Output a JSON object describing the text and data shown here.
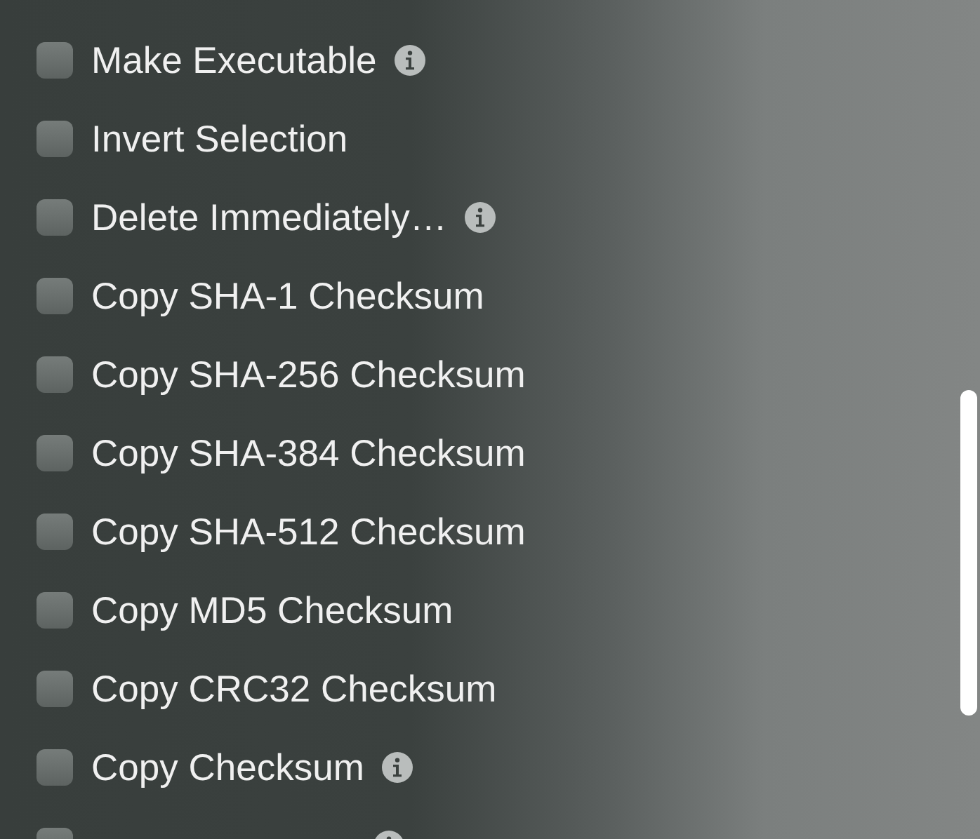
{
  "actions": [
    {
      "label": "Make Executable",
      "checked": false,
      "info": true
    },
    {
      "label": "Invert Selection",
      "checked": false,
      "info": false
    },
    {
      "label": "Delete Immediately…",
      "checked": false,
      "info": true
    },
    {
      "label": "Copy SHA-1 Checksum",
      "checked": false,
      "info": false
    },
    {
      "label": "Copy SHA-256 Checksum",
      "checked": false,
      "info": false
    },
    {
      "label": "Copy SHA-384 Checksum",
      "checked": false,
      "info": false
    },
    {
      "label": "Copy SHA-512 Checksum",
      "checked": false,
      "info": false
    },
    {
      "label": "Copy MD5 Checksum",
      "checked": false,
      "info": false
    },
    {
      "label": "Copy CRC32 Checksum",
      "checked": false,
      "info": false
    },
    {
      "label": "Copy Checksum",
      "checked": false,
      "info": true
    },
    {
      "checked": false,
      "info": true
    }
  ]
}
